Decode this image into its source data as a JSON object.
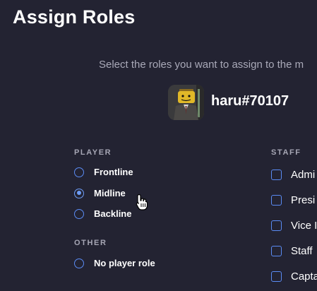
{
  "header": {
    "title": "Assign Roles"
  },
  "instructions": "Select the roles you want to assign to the m",
  "user": {
    "username": "haru#70107",
    "avatar_icon": "lego-figure-avatar"
  },
  "player_section": {
    "heading": "PLAYER",
    "options": [
      {
        "label": "Frontline",
        "selected": false
      },
      {
        "label": "Midline",
        "selected": true
      },
      {
        "label": "Backline",
        "selected": false
      }
    ]
  },
  "other_section": {
    "heading": "OTHER",
    "options": [
      {
        "label": "No player role",
        "selected": false
      }
    ]
  },
  "staff_section": {
    "heading": "STAFF",
    "options": [
      {
        "label": "Admi",
        "checked": false
      },
      {
        "label": "Presi",
        "checked": false
      },
      {
        "label": "Vice I",
        "checked": false
      },
      {
        "label": "Staff",
        "checked": false
      },
      {
        "label": "Capta",
        "checked": false
      }
    ]
  },
  "colors": {
    "background": "#232332",
    "accent": "#5b8cf5",
    "muted_text": "#a9a9b8"
  }
}
